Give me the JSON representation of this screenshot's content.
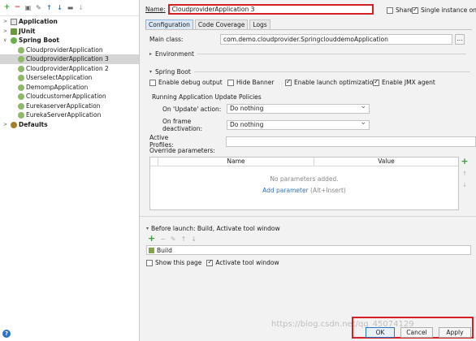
{
  "toolbar": {
    "icons": [
      "add-icon",
      "remove-icon",
      "copy-icon",
      "wrench-icon",
      "move-up-icon",
      "move-down-icon",
      "folder-icon",
      "sort-icon"
    ]
  },
  "tree": {
    "items": [
      {
        "label": "Application",
        "kind": "app",
        "bold": true,
        "level": 0,
        "expandable": true
      },
      {
        "label": "JUnit",
        "kind": "junit",
        "bold": true,
        "level": 0,
        "expandable": true
      },
      {
        "label": "Spring Boot",
        "kind": "spring",
        "bold": true,
        "level": 0,
        "expandable": true,
        "expanded": true
      },
      {
        "label": "CloudproviderApplication",
        "kind": "gear",
        "level": 1
      },
      {
        "label": "CloudproviderApplication 3",
        "kind": "gear",
        "level": 1,
        "selected": true
      },
      {
        "label": "CloudproviderApplication 2",
        "kind": "gear",
        "level": 1
      },
      {
        "label": "UserselectApplication",
        "kind": "gear",
        "level": 1
      },
      {
        "label": "DemompApplication",
        "kind": "gear",
        "level": 1
      },
      {
        "label": "CloudcustomerApplication",
        "kind": "gear",
        "level": 1
      },
      {
        "label": "EurekaserverApplication",
        "kind": "gear",
        "level": 1
      },
      {
        "label": "EurekaServerApplication",
        "kind": "gear",
        "level": 1
      },
      {
        "label": "Defaults",
        "kind": "defaults",
        "bold": true,
        "level": 0,
        "expandable": true
      }
    ]
  },
  "header": {
    "name_label": "Name:",
    "name_value": "CloudproviderApplication 3",
    "share_label": "Share",
    "single_instance_label": "Single instance only"
  },
  "tabs": [
    "Configuration",
    "Code Coverage",
    "Logs"
  ],
  "config": {
    "main_class_label": "Main class:",
    "main_class_value": "com.demo.cloudprovider.SpringclouddemoApplication",
    "browse_label": "...",
    "environment_label": "Environment",
    "spring_boot_label": "Spring Boot",
    "options": [
      {
        "label": "Enable debug output",
        "checked": false
      },
      {
        "label": "Hide Banner",
        "checked": false
      },
      {
        "label": "Enable launch optimization",
        "checked": true
      },
      {
        "label": "Enable JMX agent",
        "checked": true
      }
    ],
    "update_policies_label": "Running Application Update Policies",
    "on_update_label": "On 'Update' action:",
    "on_update_value": "Do nothing",
    "on_frame_label": "On frame deactivation:",
    "on_frame_value": "Do nothing",
    "active_profiles_label": "Active Profiles:",
    "override_label": "Override parameters:",
    "table": {
      "columns": [
        "Name",
        "Value"
      ],
      "empty_text": "No parameters added.",
      "add_link": "Add parameter",
      "add_hint": "(Alt+Insert)"
    }
  },
  "before_launch": {
    "label": "Before launch: Build, Activate tool window",
    "task": "Build",
    "show_page_label": "Show this page",
    "activate_label": "Activate tool window"
  },
  "buttons": {
    "ok": "OK",
    "cancel": "Cancel",
    "apply": "Apply"
  },
  "watermark": "https://blog.csdn.net/qq_45074129",
  "colors": {
    "highlight_border": "#d71f26",
    "link": "#2b72c9",
    "spring_green": "#6ab04c"
  }
}
